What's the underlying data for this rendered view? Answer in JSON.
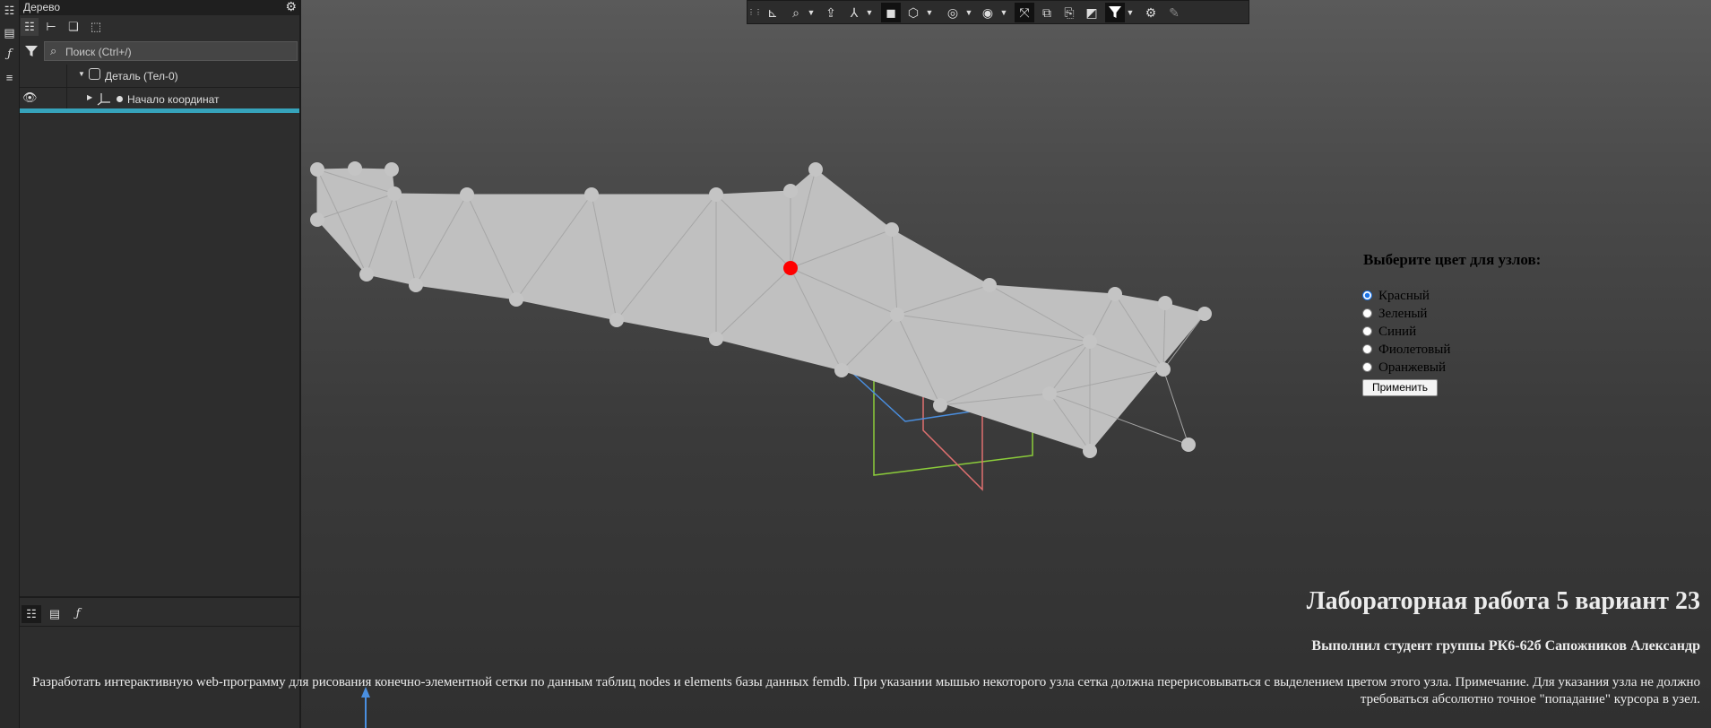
{
  "tree_panel": {
    "title": "Дерево",
    "search_placeholder": "Поиск (Ctrl+/)",
    "items": [
      {
        "label": "Деталь (Тел-0)"
      },
      {
        "label": "Начало координат"
      }
    ]
  },
  "form": {
    "title": "Выберите цвет для узлов:",
    "options": [
      "Красный",
      "Зеленый",
      "Синий",
      "Фиолетовый",
      "Оранжевый"
    ],
    "selected": "Красный",
    "apply_label": "Применить"
  },
  "footer": {
    "lab_title": "Лабораторная работа 5 вариант 23",
    "student": "Выполнил студент группы РК6-62б Сапожников Александр",
    "task": "Разработать интерактивную web-программу для рисования конечно-элементной сетки по данным таблиц nodes и elements базы данных femdb. При указании мышью некоторого узла сетка должна перерисовываться с выделением цветом этого узла. Примечание. Для указания узла не должно требоваться абсолютно точное \"попадание\" курсора в узел."
  },
  "mesh": {
    "fill_color": "#c0c0c0",
    "edge_color": "#a6a6a6",
    "node_color": "#c4c4c4",
    "selected_node_color": "#ff0000"
  },
  "colors": {
    "accent": "#36a3bb"
  }
}
